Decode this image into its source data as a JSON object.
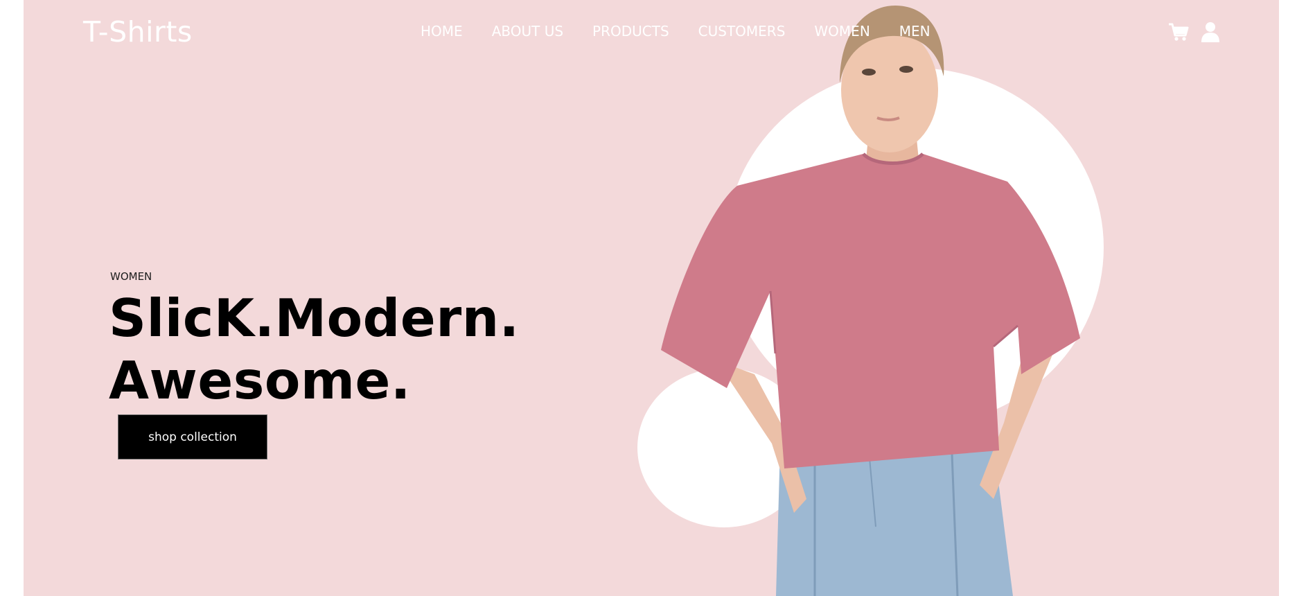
{
  "brand": {
    "logo_text": "T-Shirts"
  },
  "nav": {
    "items": [
      {
        "label": "HOME"
      },
      {
        "label": "ABOUT US"
      },
      {
        "label": "PRODUCTS"
      },
      {
        "label": "CUSTOMERS"
      },
      {
        "label": "WOMEN"
      },
      {
        "label": "MEN"
      }
    ]
  },
  "header_icons": [
    "cart-icon",
    "user-icon"
  ],
  "hero": {
    "eyebrow": "WOMEN",
    "headline_line1": "SlicK.Modern.",
    "headline_line2": "Awesome.",
    "cta_label": "shop collection",
    "image": "model-in-pink-oversized-tshirt-and-jeans"
  },
  "colors": {
    "hero_background": "#f3d9da",
    "shirt_pink": "#cf7b8a",
    "jeans_blue": "#9db8d2",
    "text_dark": "#000000",
    "nav_text": "#ffffff"
  }
}
